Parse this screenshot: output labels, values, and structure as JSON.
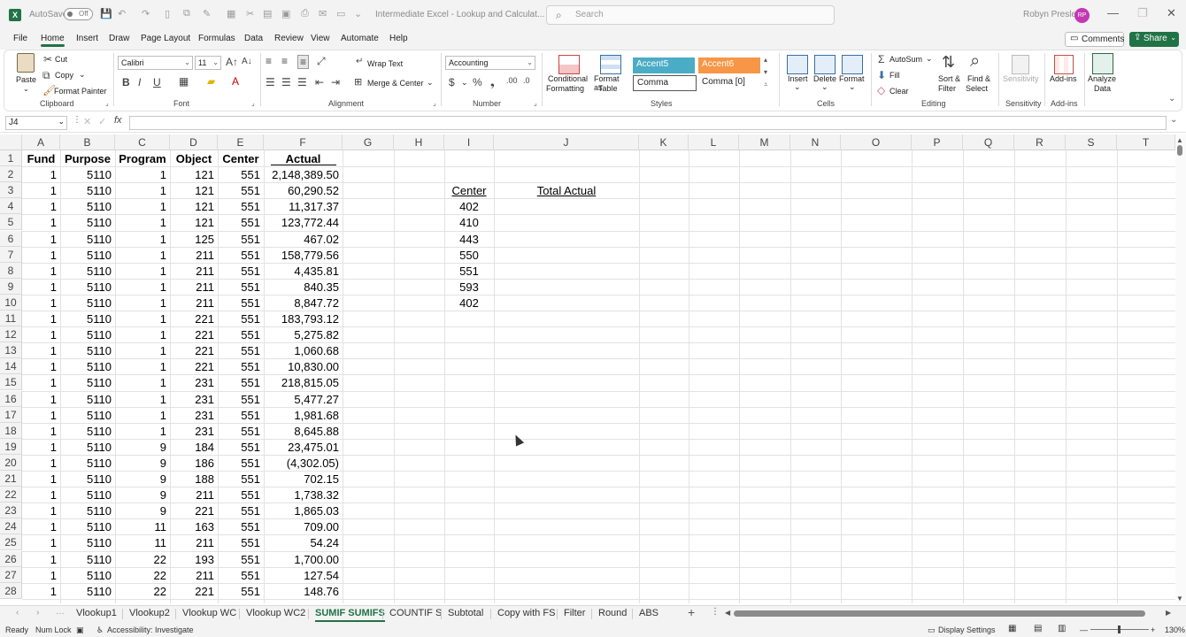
{
  "titlebar": {
    "autosave_label": "AutoSave",
    "autosave_state": "Off",
    "doc_title": "Intermediate Excel - Lookup and Calculat...",
    "search_placeholder": "Search",
    "user_name": "Robyn Presley",
    "user_initials": "RP"
  },
  "menu": {
    "items": [
      "File",
      "Home",
      "Insert",
      "Draw",
      "Page Layout",
      "Formulas",
      "Data",
      "Review",
      "View",
      "Automate",
      "Help"
    ],
    "active": "Home",
    "comments_label": "Comments",
    "share_label": "Share"
  },
  "ribbon": {
    "clipboard": {
      "paste": "Paste",
      "cut": "Cut",
      "copy": "Copy",
      "format_painter": "Format Painter",
      "label": "Clipboard"
    },
    "font": {
      "font_name": "Calibri",
      "font_size": "11",
      "label": "Font"
    },
    "alignment": {
      "wrap_text": "Wrap Text",
      "merge_center": "Merge & Center",
      "label": "Alignment"
    },
    "number": {
      "format": "Accounting",
      "label": "Number"
    },
    "styles": {
      "conditional": "Conditional",
      "formatting": "Formatting",
      "format_as": "Format as",
      "table": "Table",
      "accent5": "Accent5",
      "accent6": "Accent6",
      "comma": "Comma",
      "comma0": "Comma [0]",
      "label": "Styles",
      "accent5_color": "#4bacc6",
      "accent6_color": "#f79646"
    },
    "cells": {
      "insert": "Insert",
      "delete": "Delete",
      "format": "Format",
      "label": "Cells"
    },
    "editing": {
      "autosum": "AutoSum",
      "fill": "Fill",
      "clear": "Clear",
      "sort_filter_1": "Sort &",
      "sort_filter_2": "Filter",
      "find_select_1": "Find &",
      "find_select_2": "Select",
      "label": "Editing"
    },
    "sensitivity": {
      "button": "Sensitivity",
      "label": "Sensitivity"
    },
    "addins": {
      "button": "Add-ins",
      "label": "Add-ins"
    },
    "analyze": {
      "line1": "Analyze",
      "line2": "Data"
    }
  },
  "formula_bar": {
    "name_box": "J4",
    "formula": ""
  },
  "columns": [
    "A",
    "B",
    "C",
    "D",
    "E",
    "F",
    "G",
    "H",
    "I",
    "J",
    "K",
    "L",
    "M",
    "N",
    "O",
    "P",
    "Q",
    "R",
    "S",
    "T"
  ],
  "headers": {
    "fund": "Fund",
    "purpose": "Purpose",
    "program": "Program",
    "object": "Object",
    "center": "Center",
    "actual": "Actual"
  },
  "rows": [
    [
      "1",
      "5110",
      "1",
      "121",
      "551",
      "2,148,389.50"
    ],
    [
      "1",
      "5110",
      "1",
      "121",
      "551",
      "60,290.52"
    ],
    [
      "1",
      "5110",
      "1",
      "121",
      "551",
      "11,317.37"
    ],
    [
      "1",
      "5110",
      "1",
      "121",
      "551",
      "123,772.44"
    ],
    [
      "1",
      "5110",
      "1",
      "125",
      "551",
      "467.02"
    ],
    [
      "1",
      "5110",
      "1",
      "211",
      "551",
      "158,779.56"
    ],
    [
      "1",
      "5110",
      "1",
      "211",
      "551",
      "4,435.81"
    ],
    [
      "1",
      "5110",
      "1",
      "211",
      "551",
      "840.35"
    ],
    [
      "1",
      "5110",
      "1",
      "211",
      "551",
      "8,847.72"
    ],
    [
      "1",
      "5110",
      "1",
      "221",
      "551",
      "183,793.12"
    ],
    [
      "1",
      "5110",
      "1",
      "221",
      "551",
      "5,275.82"
    ],
    [
      "1",
      "5110",
      "1",
      "221",
      "551",
      "1,060.68"
    ],
    [
      "1",
      "5110",
      "1",
      "221",
      "551",
      "10,830.00"
    ],
    [
      "1",
      "5110",
      "1",
      "231",
      "551",
      "218,815.05"
    ],
    [
      "1",
      "5110",
      "1",
      "231",
      "551",
      "5,477.27"
    ],
    [
      "1",
      "5110",
      "1",
      "231",
      "551",
      "1,981.68"
    ],
    [
      "1",
      "5110",
      "1",
      "231",
      "551",
      "8,645.88"
    ],
    [
      "1",
      "5110",
      "9",
      "184",
      "551",
      "23,475.01"
    ],
    [
      "1",
      "5110",
      "9",
      "186",
      "551",
      "(4,302.05)"
    ],
    [
      "1",
      "5110",
      "9",
      "188",
      "551",
      "702.15"
    ],
    [
      "1",
      "5110",
      "9",
      "211",
      "551",
      "1,738.32"
    ],
    [
      "1",
      "5110",
      "9",
      "221",
      "551",
      "1,865.03"
    ],
    [
      "1",
      "5110",
      "11",
      "163",
      "551",
      "709.00"
    ],
    [
      "1",
      "5110",
      "11",
      "211",
      "551",
      "54.24"
    ],
    [
      "1",
      "5110",
      "22",
      "193",
      "551",
      "1,700.00"
    ],
    [
      "1",
      "5110",
      "22",
      "211",
      "551",
      "127.54"
    ],
    [
      "1",
      "5110",
      "22",
      "221",
      "551",
      "148.76"
    ]
  ],
  "summary": {
    "center_header": "Center",
    "total_header": "Total Actual",
    "centers": [
      "402",
      "410",
      "443",
      "550",
      "551",
      "593",
      "402"
    ]
  },
  "sheet_tabs": [
    "Vlookup1",
    "Vlookup2",
    "Vlookup WC",
    "Vlookup WC2",
    "SUMIF SUMIFS",
    "COUNTIF S",
    "Subtotal",
    "Copy with FS",
    "Filter",
    "Round",
    "ABS"
  ],
  "active_tab": "SUMIF SUMIFS",
  "status": {
    "ready": "Ready",
    "num_lock": "Num Lock",
    "accessibility": "Accessibility: Investigate",
    "display_settings": "Display Settings",
    "zoom": "130%"
  }
}
